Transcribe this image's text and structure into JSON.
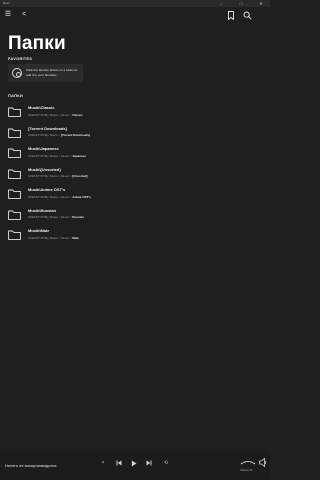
{
  "window": {
    "title": "Boxx"
  },
  "header": {
    "title": "Папки"
  },
  "favorites": {
    "label": "FAVORITES",
    "hint": "Click the favorite button on a folder to add it to your favorites"
  },
  "folders": {
    "label": "ПАПКИ",
    "items": [
      {
        "name": "Musik\\Classic",
        "path_prefix": "\\\\DESKTOP\\My Share > Music > ",
        "path_leaf": "Classic"
      },
      {
        "name": "[Torrent Downloads]",
        "path_prefix": "\\\\DESKTOP\\My Share > ",
        "path_leaf": "[Torrent Downloads]"
      },
      {
        "name": "Musik\\Japanese",
        "path_prefix": "\\\\DESKTOP\\My Share > Music > ",
        "path_leaf": "Japanese"
      },
      {
        "name": "Musik\\[Unsorted]",
        "path_prefix": "\\\\DESKTOP\\My Share > Music > ",
        "path_leaf": "[Unsorted]"
      },
      {
        "name": "Musik\\Anime OST's",
        "path_prefix": "\\\\DESKTOP\\My Share > Music > ",
        "path_leaf": "Anime OST's"
      },
      {
        "name": "Musik\\Russian",
        "path_prefix": "\\\\DESKTOP\\My Share > Music > ",
        "path_leaf": "Russian"
      },
      {
        "name": "Musik\\Male",
        "path_prefix": "\\\\DESKTOP\\My Share > Music > ",
        "path_leaf": "Male"
      }
    ]
  },
  "player": {
    "status": "Ничего не воспроизводится",
    "volume_label": "Volume 94"
  },
  "colors": {
    "background": "#1f1f1f",
    "card": "#2b2b2b",
    "text": "#ffffff",
    "muted": "#9a9a9a"
  }
}
